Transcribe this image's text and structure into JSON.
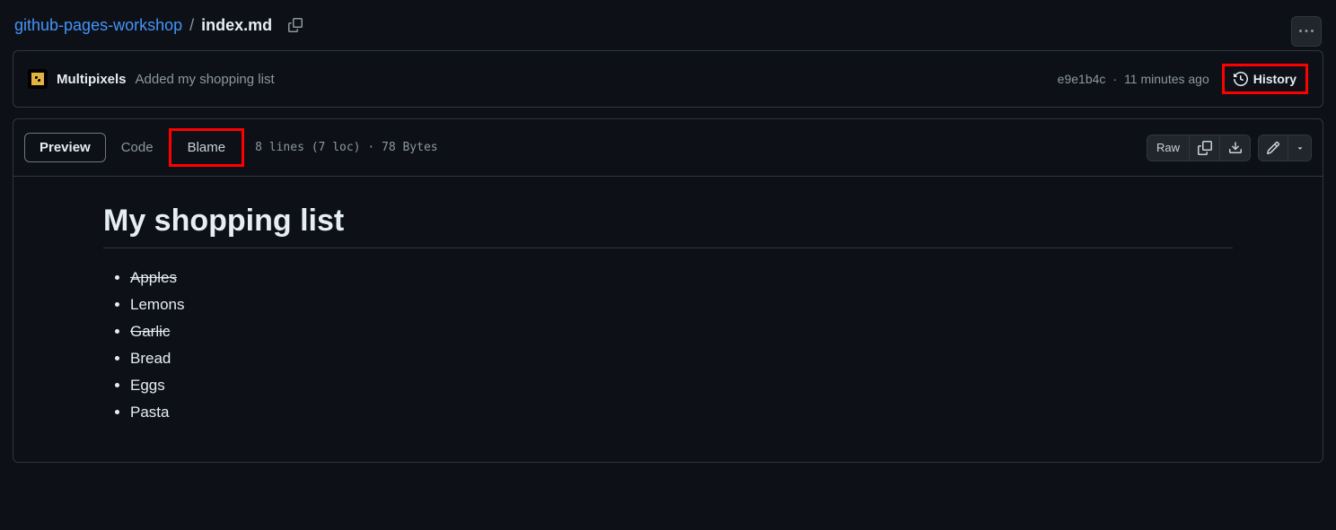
{
  "breadcrumb": {
    "repo": "github-pages-workshop",
    "file": "index.md"
  },
  "commit": {
    "author": "Multipixels",
    "message": "Added my shopping list",
    "hash": "e9e1b4c",
    "time": "11 minutes ago",
    "history_label": "History"
  },
  "tabs": {
    "preview": "Preview",
    "code": "Code",
    "blame": "Blame"
  },
  "file_meta": "8 lines (7 loc) · 78 Bytes",
  "actions": {
    "raw": "Raw"
  },
  "document": {
    "heading": "My shopping list",
    "items": [
      {
        "text": "Apples",
        "done": true
      },
      {
        "text": "Lemons",
        "done": false
      },
      {
        "text": "Garlic",
        "done": true
      },
      {
        "text": "Bread",
        "done": false
      },
      {
        "text": "Eggs",
        "done": false
      },
      {
        "text": "Pasta",
        "done": false
      }
    ]
  }
}
